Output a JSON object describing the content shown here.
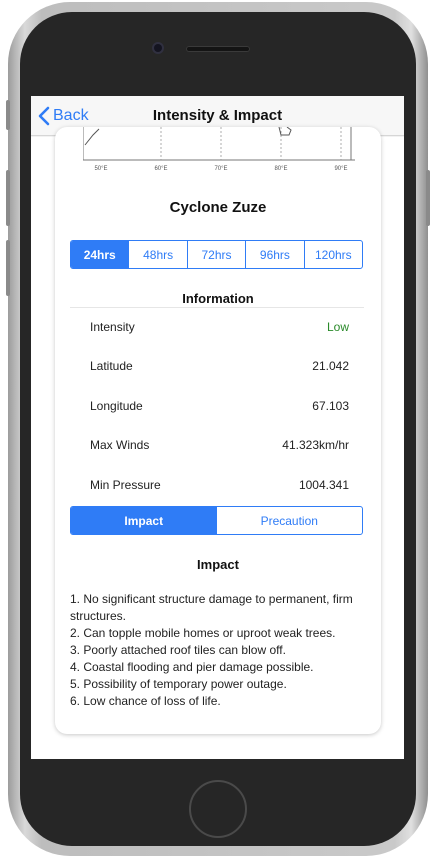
{
  "nav": {
    "back_label": "Back",
    "title": "Intensity & Impact"
  },
  "map": {
    "longitude_ticks": [
      "50°E",
      "60°E",
      "70°E",
      "80°E",
      "90°E"
    ]
  },
  "cyclone": {
    "name": "Cyclone Zuze"
  },
  "forecast_tabs": [
    {
      "label": "24hrs",
      "active": true
    },
    {
      "label": "48hrs",
      "active": false
    },
    {
      "label": "72hrs",
      "active": false
    },
    {
      "label": "96hrs",
      "active": false
    },
    {
      "label": "120hrs",
      "active": false
    }
  ],
  "information": {
    "title": "Information",
    "rows": [
      {
        "label": "Intensity",
        "value": "Low"
      },
      {
        "label": "Latitude",
        "value": "21.042"
      },
      {
        "label": "Longitude",
        "value": "67.103"
      },
      {
        "label": "Max Winds",
        "value": "41.323km/hr"
      },
      {
        "label": "Min Pressure",
        "value": "1004.341"
      }
    ]
  },
  "segment": {
    "options": [
      {
        "label": "Impact",
        "active": true
      },
      {
        "label": "Precaution",
        "active": false
      }
    ]
  },
  "impact": {
    "title": "Impact",
    "items": [
      "1. No significant structure damage to permanent, firm structures.",
      "2. Can topple mobile homes or uproot weak trees.",
      "3. Poorly attached roof tiles can blow off.",
      "4. Coastal flooding and pier damage possible.",
      "5. Possibility of temporary power outage.",
      "6. Low chance of loss of life."
    ]
  },
  "colors": {
    "accent": "#2f7cf6",
    "intensity_low": "#2a8a2a"
  }
}
